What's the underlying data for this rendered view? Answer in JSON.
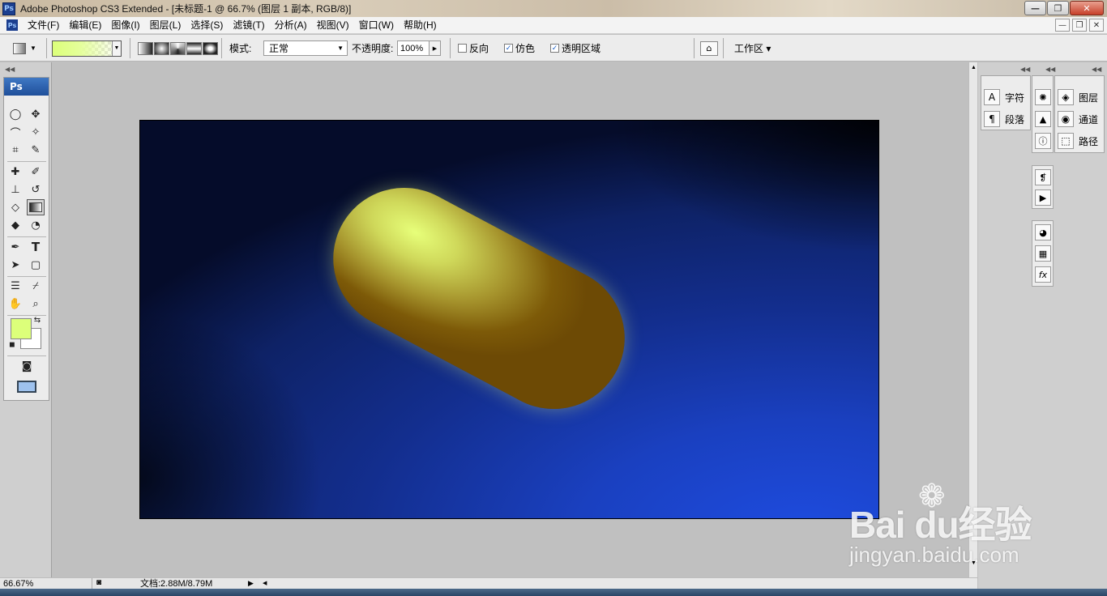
{
  "window": {
    "title": "Adobe Photoshop CS3 Extended - [未标题-1 @ 66.7% (图层 1 副本, RGB/8)]",
    "app_icon": "Ps",
    "controls": [
      "—",
      "❐",
      "✕"
    ]
  },
  "menubar": {
    "doc_icon": "Ps",
    "items": [
      "文件(F)",
      "编辑(E)",
      "图像(I)",
      "图层(L)",
      "选择(S)",
      "滤镜(T)",
      "分析(A)",
      "视图(V)",
      "窗口(W)",
      "帮助(H)"
    ],
    "mdi_controls": [
      "—",
      "❐",
      "✕"
    ]
  },
  "options": {
    "mode_label": "模式:",
    "mode_value": "正常",
    "opacity_label": "不透明度:",
    "opacity_value": "100%",
    "reverse_label": "反向",
    "dither_label": "仿色",
    "transparency_label": "透明区域",
    "reverse_checked": false,
    "dither_checked": true,
    "transparency_checked": true,
    "workspace_label": "工作区 ▾",
    "gradient_color": "#dcff7a"
  },
  "toolbox": {
    "header": "Ps",
    "foreground": "#dcff7a",
    "background": "#ffffff"
  },
  "status": {
    "zoom": "66.67%",
    "doc_info": "文档:2.88M/8.79M"
  },
  "panels": {
    "character": "字符",
    "paragraph": "段落",
    "layers": "图层",
    "channels": "通道",
    "paths": "路径"
  },
  "watermark": {
    "brand": "Bai du经验",
    "url": "jingyan.baidu.com"
  }
}
